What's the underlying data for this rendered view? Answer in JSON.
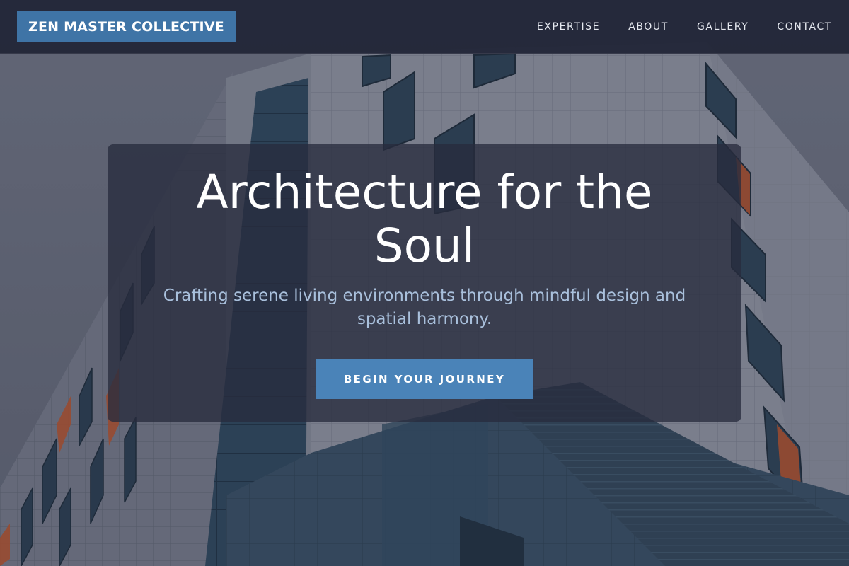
{
  "header": {
    "logo": "ZEN MASTER COLLECTIVE",
    "nav": [
      {
        "label": "EXPERTISE"
      },
      {
        "label": "ABOUT"
      },
      {
        "label": "GALLERY"
      },
      {
        "label": "CONTACT"
      }
    ]
  },
  "hero": {
    "title": "Architecture for the Soul",
    "subtitle": "Crafting serene living environments through mindful design and spatial harmony.",
    "cta_label": "BEGIN YOUR JOURNEY"
  },
  "colors": {
    "header_bg": "#222638",
    "logo_bg": "#3f74a6",
    "cta_bg": "#4a83b8",
    "subtitle": "#a9c0dc",
    "accent_window": "#c4582c"
  }
}
